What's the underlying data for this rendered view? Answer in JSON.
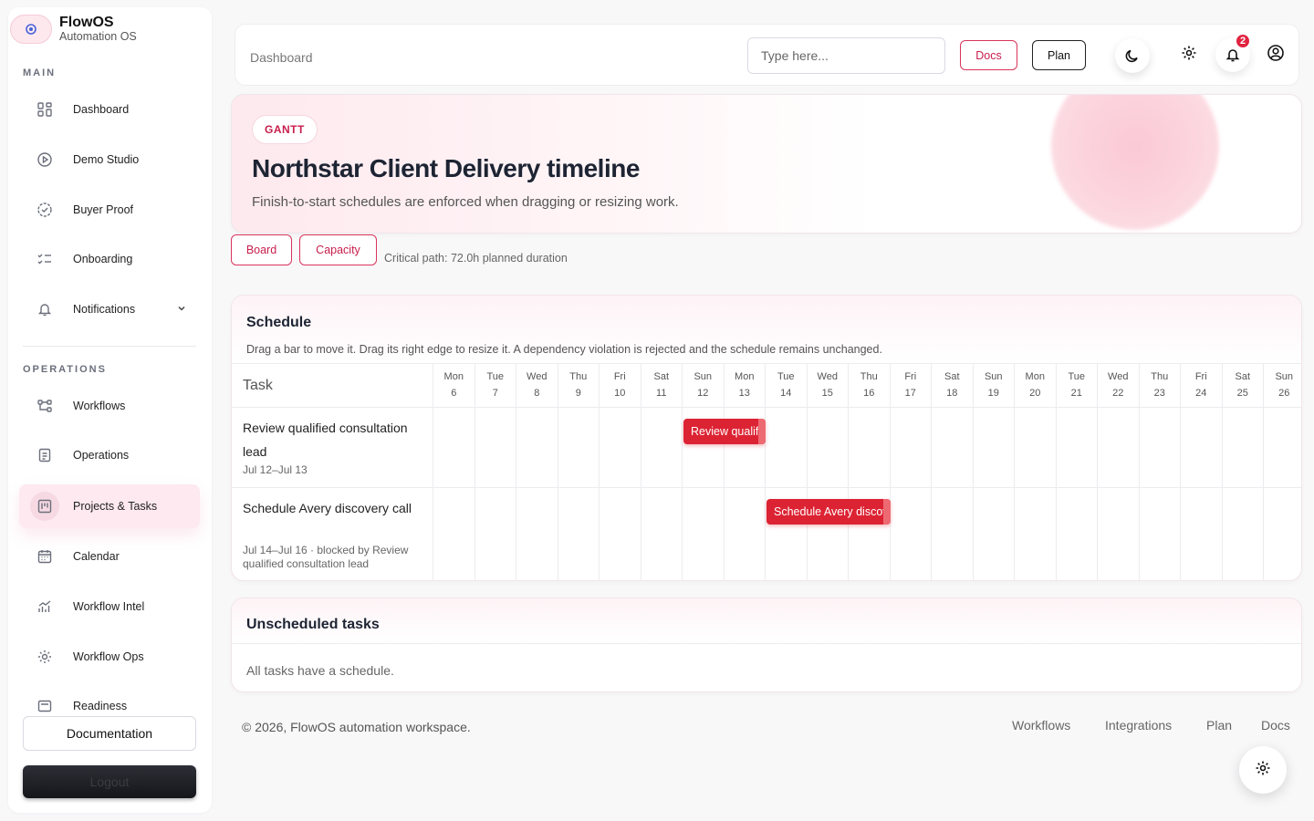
{
  "brand": {
    "name": "FlowOS",
    "subtitle": "Automation OS"
  },
  "sidebar": {
    "main_label": "MAIN",
    "main_items": [
      {
        "label": "Dashboard",
        "icon": "dashboard-icon"
      },
      {
        "label": "Demo Studio",
        "icon": "play-icon"
      },
      {
        "label": "Buyer Proof",
        "icon": "check-circle-icon"
      },
      {
        "label": "Onboarding",
        "icon": "checklist-icon"
      },
      {
        "label": "Notifications",
        "icon": "bell-icon"
      }
    ],
    "ops_label": "OPERATIONS",
    "ops_items": [
      {
        "label": "Workflows",
        "icon": "workflow-icon"
      },
      {
        "label": "Operations",
        "icon": "clipboard-icon"
      },
      {
        "label": "Projects & Tasks",
        "icon": "kanban-icon",
        "active": true
      },
      {
        "label": "Calendar",
        "icon": "calendar-icon"
      },
      {
        "label": "Workflow Intel",
        "icon": "chart-icon"
      },
      {
        "label": "Workflow Ops",
        "icon": "gear-icon"
      },
      {
        "label": "Readiness",
        "icon": "readiness-icon"
      }
    ],
    "documentation_label": "Documentation",
    "logout_label": "Logout"
  },
  "topbar": {
    "breadcrumb": "Dashboard",
    "search_placeholder": "Type here...",
    "docs_label": "Docs",
    "plan_label": "Plan",
    "notification_count": "2"
  },
  "hero": {
    "tag": "GANTT",
    "title": "Northstar Client Delivery timeline",
    "subtitle": "Finish-to-start schedules are enforced when dragging or resizing work."
  },
  "actions": {
    "board_label": "Board",
    "capacity_label": "Capacity",
    "critical_path": "Critical path: 72.0h planned duration"
  },
  "schedule": {
    "title": "Schedule",
    "description": "Drag a bar to move it. Drag its right edge to resize it. A dependency violation is rejected and the schedule remains unchanged.",
    "task_header": "Task",
    "days": [
      {
        "dow": "Mon",
        "date": "6"
      },
      {
        "dow": "Tue",
        "date": "7"
      },
      {
        "dow": "Wed",
        "date": "8"
      },
      {
        "dow": "Thu",
        "date": "9"
      },
      {
        "dow": "Fri",
        "date": "10"
      },
      {
        "dow": "Sat",
        "date": "11"
      },
      {
        "dow": "Sun",
        "date": "12"
      },
      {
        "dow": "Mon",
        "date": "13"
      },
      {
        "dow": "Tue",
        "date": "14"
      },
      {
        "dow": "Wed",
        "date": "15"
      },
      {
        "dow": "Thu",
        "date": "16"
      },
      {
        "dow": "Fri",
        "date": "17"
      },
      {
        "dow": "Sat",
        "date": "18"
      },
      {
        "dow": "Sun",
        "date": "19"
      },
      {
        "dow": "Mon",
        "date": "20"
      },
      {
        "dow": "Tue",
        "date": "21"
      },
      {
        "dow": "Wed",
        "date": "22"
      },
      {
        "dow": "Thu",
        "date": "23"
      },
      {
        "dow": "Fri",
        "date": "24"
      },
      {
        "dow": "Sat",
        "date": "25"
      },
      {
        "dow": "Sun",
        "date": "26"
      }
    ],
    "tasks": [
      {
        "name": "Review qualified consultation lead",
        "meta": "Jul 12–Jul 13",
        "bar_label": "Review qualified consultation lead",
        "start_index": 6,
        "span_days": 2
      },
      {
        "name": "Schedule Avery discovery call",
        "meta": "Jul 14–Jul 16 · blocked by Review qualified consultation lead",
        "bar_label": "Schedule Avery discovery call",
        "start_index": 8,
        "span_days": 3
      }
    ]
  },
  "unscheduled": {
    "title": "Unscheduled tasks",
    "empty_text": "All tasks have a schedule."
  },
  "footer": {
    "copyright": "© 2026, FlowOS automation workspace.",
    "links": [
      "Workflows",
      "Integrations",
      "Plan",
      "Docs"
    ]
  }
}
